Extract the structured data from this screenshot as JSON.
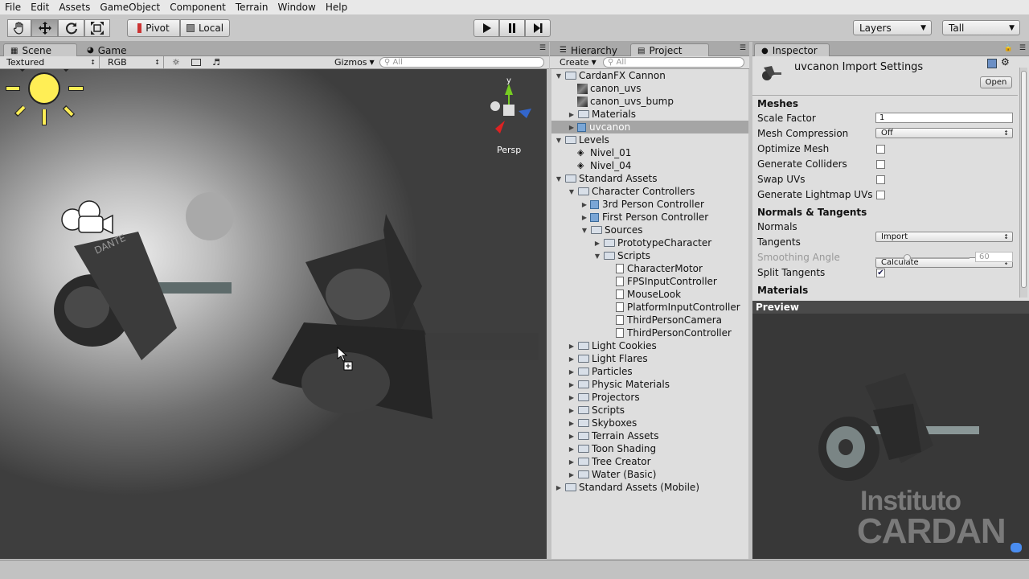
{
  "menu": [
    "File",
    "Edit",
    "Assets",
    "GameObject",
    "Component",
    "Terrain",
    "Window",
    "Help"
  ],
  "toolbar": {
    "tools": [
      "hand-icon",
      "move-icon",
      "rotate-icon",
      "scale-icon"
    ],
    "pivot": "Pivot",
    "local": "Local",
    "layers": "Layers",
    "layout": "Tall"
  },
  "scene_panel": {
    "tab_scene": "Scene",
    "tab_game": "Game",
    "render_mode": "Textured",
    "color_mode": "RGB",
    "gizmos": "Gizmos",
    "search_placeholder": "All",
    "view_label": "Persp",
    "gizmo_y": "y"
  },
  "project_panel": {
    "tab_hierarchy": "Hierarchy",
    "tab_project": "Project",
    "create": "Create",
    "search_placeholder": "All",
    "items": [
      {
        "label": "CardanFX Cannon",
        "indent": 0,
        "fold": "open",
        "icon": "folder-icon"
      },
      {
        "label": "canon_uvs",
        "indent": 1,
        "fold": "",
        "icon": "texture-icon"
      },
      {
        "label": "canon_uvs_bump",
        "indent": 1,
        "fold": "",
        "icon": "texture-icon"
      },
      {
        "label": "Materials",
        "indent": 1,
        "fold": "closed",
        "icon": "folder-icon"
      },
      {
        "label": "uvcanon",
        "indent": 1,
        "fold": "closed",
        "icon": "model-icon",
        "selected": true
      },
      {
        "label": "Levels",
        "indent": 0,
        "fold": "open",
        "icon": "folder-icon"
      },
      {
        "label": "Nivel_01",
        "indent": 1,
        "fold": "",
        "icon": "unity-scene-icon"
      },
      {
        "label": "Nivel_04",
        "indent": 1,
        "fold": "",
        "icon": "unity-scene-icon"
      },
      {
        "label": "Standard Assets",
        "indent": 0,
        "fold": "open",
        "icon": "folder-icon"
      },
      {
        "label": "Character Controllers",
        "indent": 1,
        "fold": "open",
        "icon": "folder-icon"
      },
      {
        "label": "3rd Person Controller",
        "indent": 2,
        "fold": "closed",
        "icon": "prefab-icon"
      },
      {
        "label": "First Person Controller",
        "indent": 2,
        "fold": "closed",
        "icon": "prefab-icon"
      },
      {
        "label": "Sources",
        "indent": 2,
        "fold": "open",
        "icon": "folder-icon"
      },
      {
        "label": "PrototypeCharacter",
        "indent": 3,
        "fold": "closed",
        "icon": "folder-icon"
      },
      {
        "label": "Scripts",
        "indent": 3,
        "fold": "open",
        "icon": "folder-icon"
      },
      {
        "label": "CharacterMotor",
        "indent": 4,
        "fold": "",
        "icon": "script-icon"
      },
      {
        "label": "FPSInputController",
        "indent": 4,
        "fold": "",
        "icon": "script-icon"
      },
      {
        "label": "MouseLook",
        "indent": 4,
        "fold": "",
        "icon": "script-icon"
      },
      {
        "label": "PlatformInputController",
        "indent": 4,
        "fold": "",
        "icon": "script-icon"
      },
      {
        "label": "ThirdPersonCamera",
        "indent": 4,
        "fold": "",
        "icon": "script-icon"
      },
      {
        "label": "ThirdPersonController",
        "indent": 4,
        "fold": "",
        "icon": "script-icon"
      },
      {
        "label": "Light Cookies",
        "indent": 1,
        "fold": "closed",
        "icon": "folder-icon"
      },
      {
        "label": "Light Flares",
        "indent": 1,
        "fold": "closed",
        "icon": "folder-icon"
      },
      {
        "label": "Particles",
        "indent": 1,
        "fold": "closed",
        "icon": "folder-icon"
      },
      {
        "label": "Physic Materials",
        "indent": 1,
        "fold": "closed",
        "icon": "folder-icon"
      },
      {
        "label": "Projectors",
        "indent": 1,
        "fold": "closed",
        "icon": "folder-icon"
      },
      {
        "label": "Scripts",
        "indent": 1,
        "fold": "closed",
        "icon": "folder-icon"
      },
      {
        "label": "Skyboxes",
        "indent": 1,
        "fold": "closed",
        "icon": "folder-icon"
      },
      {
        "label": "Terrain Assets",
        "indent": 1,
        "fold": "closed",
        "icon": "folder-icon"
      },
      {
        "label": "Toon Shading",
        "indent": 1,
        "fold": "closed",
        "icon": "folder-icon"
      },
      {
        "label": "Tree Creator",
        "indent": 1,
        "fold": "closed",
        "icon": "folder-icon"
      },
      {
        "label": "Water (Basic)",
        "indent": 1,
        "fold": "closed",
        "icon": "folder-icon"
      },
      {
        "label": "Standard Assets (Mobile)",
        "indent": 0,
        "fold": "closed",
        "icon": "folder-icon"
      }
    ]
  },
  "inspector": {
    "tab": "Inspector",
    "title": "uvcanon Import Settings",
    "open": "Open",
    "meshes_header": "Meshes",
    "scale_factor_label": "Scale Factor",
    "scale_factor": "1",
    "mesh_compression_label": "Mesh Compression",
    "mesh_compression": "Off",
    "optimize_mesh_label": "Optimize Mesh",
    "optimize_mesh": false,
    "generate_colliders_label": "Generate Colliders",
    "generate_colliders": false,
    "swap_uvs_label": "Swap UVs",
    "swap_uvs": false,
    "lightmap_uvs_label": "Generate Lightmap UVs",
    "lightmap_uvs": false,
    "normals_header": "Normals & Tangents",
    "normals_label": "Normals",
    "normals": "Import",
    "tangents_label": "Tangents",
    "tangents": "Calculate",
    "smoothing_label": "Smoothing Angle",
    "smoothing_value": "60",
    "smoothing_fraction": 0.33,
    "split_tangents_label": "Split Tangents",
    "split_tangents": true,
    "materials_header": "Materials"
  },
  "preview": {
    "header": "Preview",
    "watermark_line1": "Instituto",
    "watermark_line2": "CARDAN"
  }
}
